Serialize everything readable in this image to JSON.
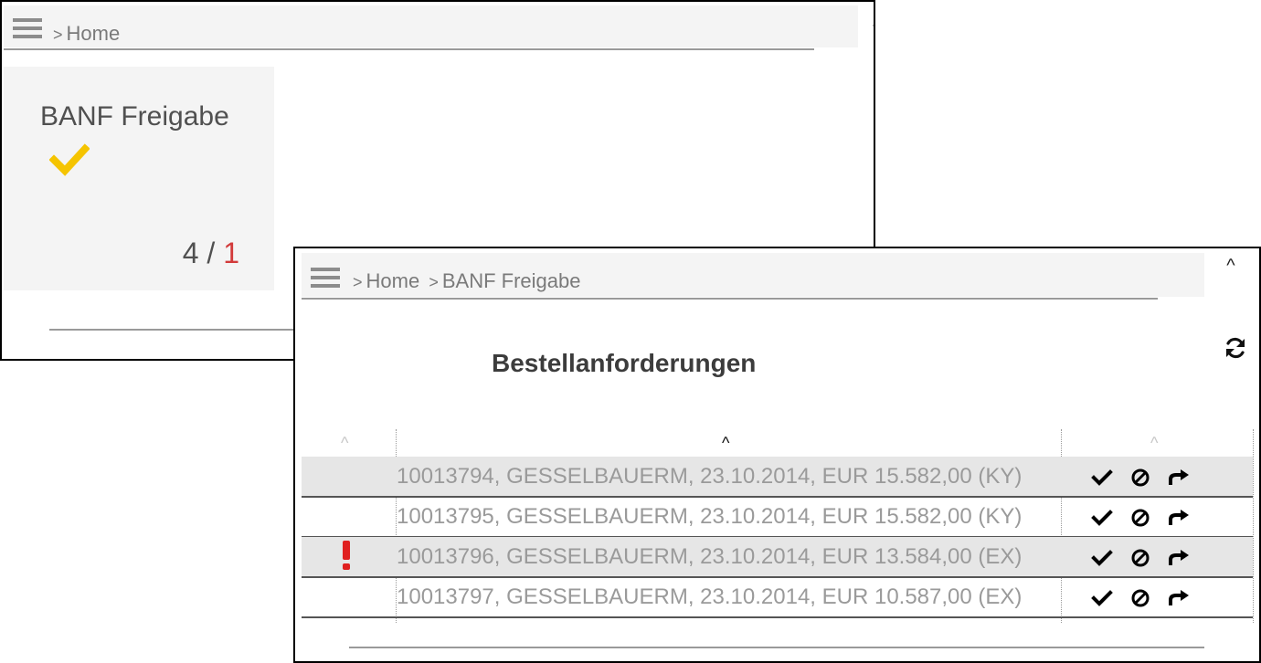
{
  "home_window": {
    "breadcrumb_sep": ">",
    "breadcrumb_home": "Home",
    "tile": {
      "title": "BANF Freigabe",
      "icon": "check-icon",
      "count_total": "4",
      "count_divider": "/",
      "count_alert": "1",
      "icon_color": "#f5c400",
      "alert_color": "#d23a3a"
    }
  },
  "detail_window": {
    "breadcrumb_sep": ">",
    "breadcrumb_home": "Home",
    "breadcrumb_current": "BANF Freigabe",
    "title": "Bestellanforderungen",
    "collapse_glyph": "^",
    "sort_glyph": "^",
    "rows": [
      {
        "text": "10013794, GESSELBAUERM, 23.10.2014, EUR 15.582,00 (KY)",
        "flag": false,
        "shaded": true
      },
      {
        "text": "10013795, GESSELBAUERM, 23.10.2014, EUR 15.582,00 (KY)",
        "flag": false,
        "shaded": false
      },
      {
        "text": "10013796, GESSELBAUERM, 23.10.2014, EUR 13.584,00 (EX)",
        "flag": true,
        "shaded": true
      },
      {
        "text": "10013797, GESSELBAUERM, 23.10.2014, EUR 10.587,00 (EX)",
        "flag": false,
        "shaded": false
      }
    ],
    "row_actions": [
      "approve-icon",
      "reject-icon",
      "forward-icon"
    ],
    "flag_color": "#e02020"
  }
}
